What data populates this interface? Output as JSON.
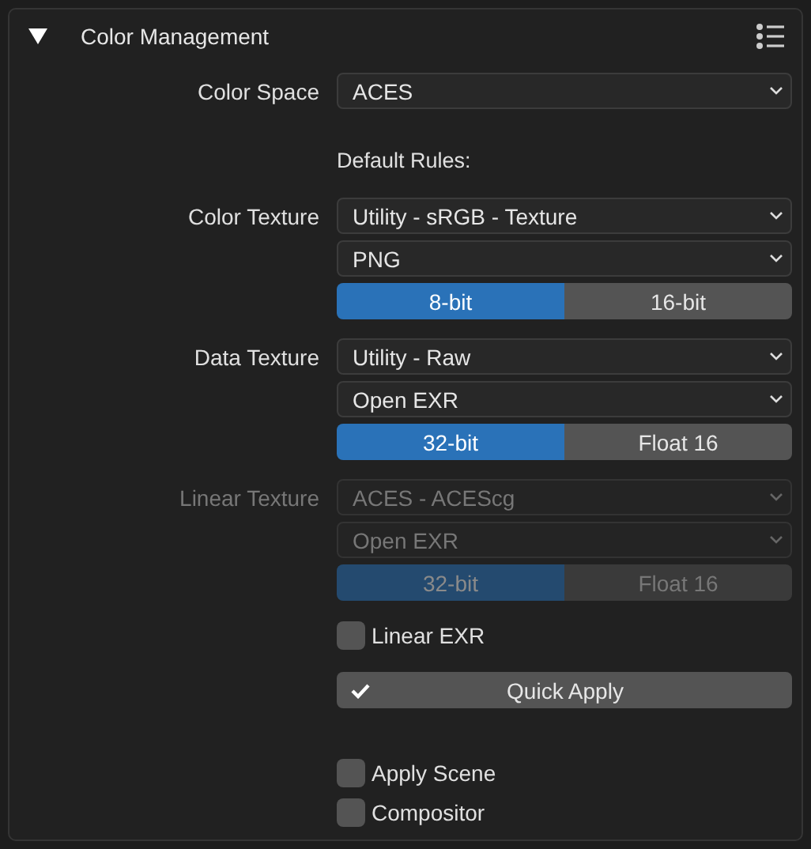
{
  "panel": {
    "title": "Color Management",
    "expanded": true
  },
  "items": [
    {
      "kind": "dropdown",
      "label": "Color Space",
      "value": "ACES",
      "disabled": false
    },
    {
      "kind": "note",
      "text": "Default Rules:"
    },
    {
      "kind": "rule",
      "label": "Color Texture",
      "disabled": false,
      "colorspace": "Utility - sRGB - Texture",
      "format": "PNG",
      "depths": [
        {
          "label": "8-bit",
          "selected": true
        },
        {
          "label": "16-bit",
          "selected": false
        }
      ]
    },
    {
      "kind": "rule",
      "label": "Data Texture",
      "disabled": false,
      "colorspace": "Utility - Raw",
      "format": "Open EXR",
      "depths": [
        {
          "label": "32-bit",
          "selected": true
        },
        {
          "label": "Float 16",
          "selected": false
        }
      ]
    },
    {
      "kind": "rule",
      "label": "Linear Texture",
      "disabled": true,
      "colorspace": "ACES - ACEScg",
      "format": "Open EXR",
      "depths": [
        {
          "label": "32-bit",
          "selected": true
        },
        {
          "label": "Float 16",
          "selected": false
        }
      ]
    },
    {
      "kind": "checkbox",
      "label": "Linear EXR",
      "checked": false
    },
    {
      "kind": "button",
      "label": "Quick Apply"
    },
    {
      "kind": "checkbox",
      "label": "Apply Scene",
      "checked": false
    },
    {
      "kind": "checkbox",
      "label": "Compositor",
      "checked": false
    }
  ]
}
